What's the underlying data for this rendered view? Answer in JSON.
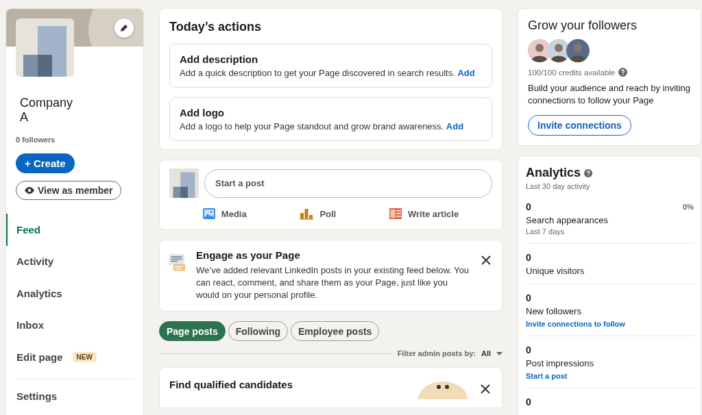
{
  "profile": {
    "name": "Company A",
    "followers": "0 followers",
    "create_button": "+ Create",
    "view_button": "View as member"
  },
  "nav": {
    "items": [
      {
        "label": "Feed",
        "selected": true
      },
      {
        "label": "Activity",
        "selected": false
      },
      {
        "label": "Analytics",
        "selected": false
      },
      {
        "label": "Inbox",
        "selected": false
      },
      {
        "label": "Edit page",
        "badge": "NEW",
        "selected": false
      }
    ],
    "settings": "Settings"
  },
  "todays_actions": {
    "title": "Today’s actions",
    "items": [
      {
        "title": "Add description",
        "text": "Add a quick description to get your Page discovered in search results.",
        "link": "Add"
      },
      {
        "title": "Add logo",
        "text": "Add a logo to help your Page standout and grow brand awareness.",
        "link": "Add"
      }
    ]
  },
  "composer": {
    "placeholder": "Start a post",
    "actions": [
      {
        "kind": "media",
        "label": "Media"
      },
      {
        "kind": "poll",
        "label": "Poll"
      },
      {
        "kind": "article",
        "label": "Write article"
      }
    ]
  },
  "engage": {
    "title": "Engage as your Page",
    "text": "We’ve added relevant LinkedIn posts in your existing feed below. You can react, comment, and share them as your Page, just like you would on your personal profile."
  },
  "feed_tabs": [
    {
      "label": "Page posts",
      "selected": true
    },
    {
      "label": "Following",
      "selected": false
    },
    {
      "label": "Employee posts",
      "selected": false
    }
  ],
  "filter": {
    "label": "Filter admin posts by:",
    "value": "All"
  },
  "promo": {
    "title": "Find qualified candidates"
  },
  "grow": {
    "title": "Grow your followers",
    "credits": "100/100 credits available",
    "text": "Build your audience and reach by inviting connections to follow your Page",
    "button": "Invite connections"
  },
  "analytics": {
    "title": "Analytics",
    "subtitle": "Last 30 day activity",
    "stats": [
      {
        "value": "0",
        "label": "Search appearances",
        "change": "0%",
        "note": "Last 7 days"
      },
      {
        "value": "0",
        "label": "Unique visitors"
      },
      {
        "value": "0",
        "label": "New followers",
        "link": "Invite connections to follow"
      },
      {
        "value": "0",
        "label": "Post impressions",
        "link": "Start a post"
      },
      {
        "value": "0"
      }
    ]
  }
}
